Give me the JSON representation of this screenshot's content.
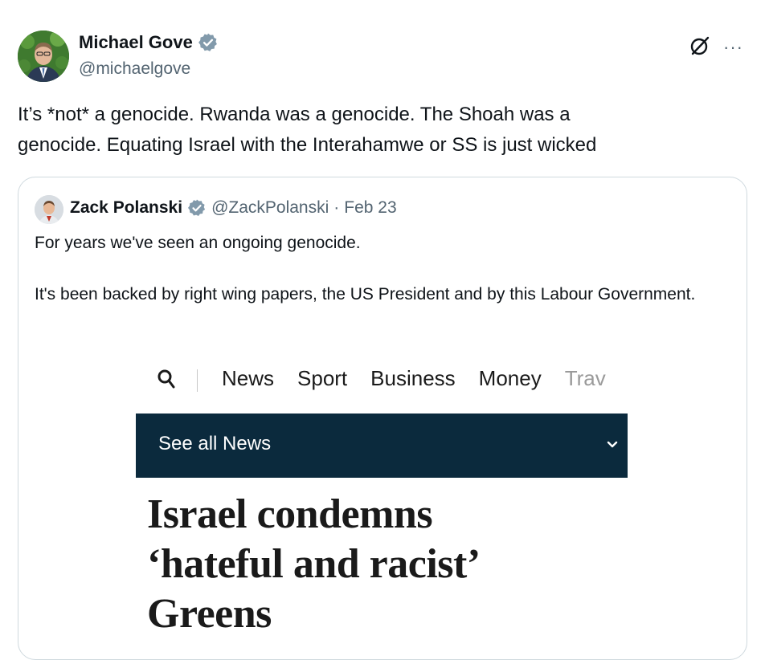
{
  "author": {
    "name": "Michael Gove",
    "handle": "@michaelgove",
    "verified_color": "#829aab"
  },
  "post": {
    "text_line1": "It’s *not* a genocide. Rwanda was a genocide. The Shoah was a",
    "text_line2": "genocide. Equating Israel with the Interahamwe or SS is just wicked"
  },
  "actions": {
    "grok_icon": "grok-icon",
    "more_label": "···"
  },
  "quoted": {
    "name": "Zack Polanski",
    "handle": "@ZackPolanski",
    "separator": "·",
    "date": "Feb 23",
    "paragraph1": "For years we've seen an ongoing genocide.",
    "paragraph2": "It's been backed by right wing papers, the US President and by this Labour Government.",
    "image": {
      "nav_items": [
        "News",
        "Sport",
        "Business",
        "Money"
      ],
      "nav_partial": "Trav",
      "bar_label": "See all News",
      "bar_color": "#0b2a3d",
      "headline_lines": [
        "Israel condemns",
        "‘hateful and racist’",
        "Greens"
      ]
    }
  }
}
